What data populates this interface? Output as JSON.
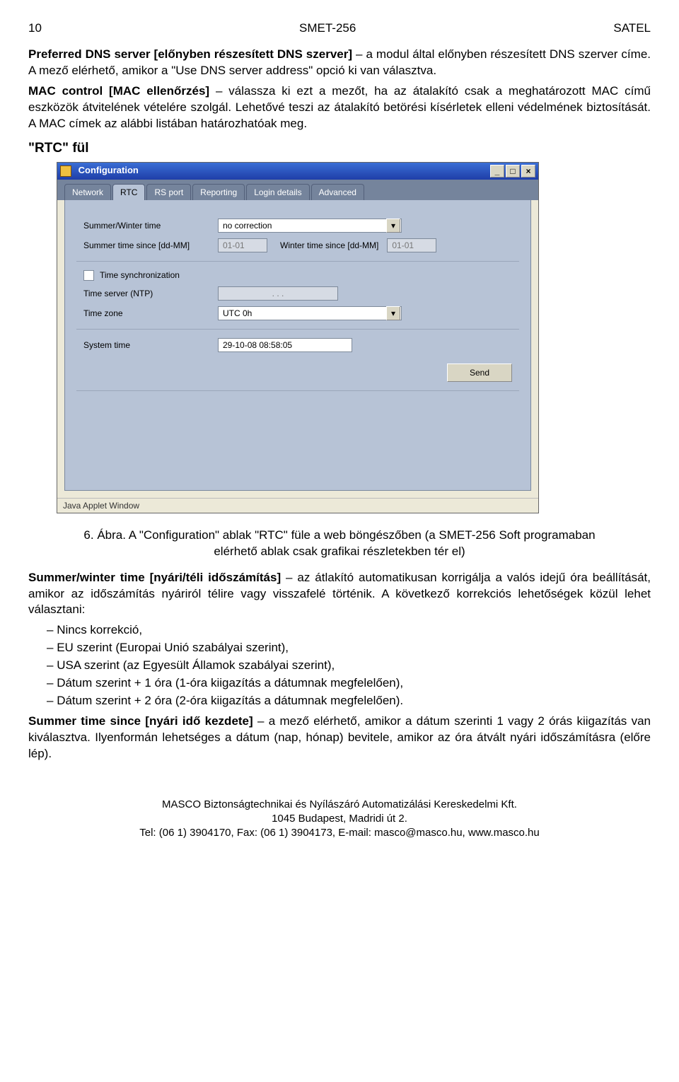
{
  "header": {
    "left": "10",
    "center": "SMET-256",
    "right": "SATEL"
  },
  "intro": {
    "p1_html": "<span class='bold'>Preferred DNS server [előnyben részesített DNS szerver]</span> – a modul által előnyben részesített DNS szerver címe. A mező elérhető, amikor a \"Use DNS server address\" opció ki van választva.",
    "p2_html": "<span class='bold'>MAC control [MAC ellenőrzés]</span> – válassza ki ezt a mezőt, ha az átalakító csak a meghatározott MAC című eszközök átvitelének vételére szolgál. Lehetővé teszi az átalakító betörési kísérletek elleni védelmének biztosítását. A MAC címek az alábbi listában határozhatóak meg."
  },
  "section_title": "\"RTC\" fül",
  "dialog": {
    "title": "Configuration",
    "win_min": "_",
    "win_max": "□",
    "win_close": "×",
    "tabs": [
      "Network",
      "RTC",
      "RS port",
      "Reporting",
      "Login details",
      "Advanced"
    ],
    "active_tab": "RTC",
    "labels": {
      "summer_winter": "Summer/Winter time",
      "summer_since": "Summer time since [dd-MM]",
      "winter_since": "Winter time since [dd-MM]",
      "time_sync": "Time synchronization",
      "ntp": "Time server (NTP)",
      "tz": "Time zone",
      "systime": "System time"
    },
    "values": {
      "summer_winter": "no correction",
      "summer_since": "01-01",
      "winter_since": "01-01",
      "ntp": ".      .      .",
      "tz": "UTC 0h",
      "systime": "29-10-08 08:58:05"
    },
    "send_btn": "Send",
    "status": "Java Applet Window",
    "arrow": "▾"
  },
  "caption": "6. Ábra. A \"Configuration\" ablak \"RTC\" füle a web böngészőben (a SMET-256 Soft programaban elérhető ablak csak grafikai részletekben tér el)",
  "after": {
    "p1_html": "<span class='bold'>Summer/winter time [nyári/téli időszámítás]</span> – az átlakító automatikusan korrigálja a valós idejű óra beállítását, amikor az időszámítás nyáriról télire vagy visszafelé történik. A következő korrekciós lehetőségek közül lehet választani:",
    "list": [
      "Nincs korrekció,",
      "EU szerint (Europai Unió szabályai szerint),",
      "USA szerint (az Egyesült Államok szabályai szerint),",
      "Dátum szerint + 1 óra (1-óra kiigazítás a dátumnak megfelelően),",
      "Dátum szerint + 2 óra (2-óra kiigazítás a dátumnak megfelelően)."
    ],
    "p2_html": "<span class='bold'>Summer time since [nyári idő kezdete]</span> – a mező elérhető, amikor a dátum szerinti 1 vagy 2 órás kiigazítás van kiválasztva. Ilyenformán lehetséges a dátum (nap, hónap) bevitele, amikor az óra átvált nyári időszámításra (előre lép)."
  },
  "footer": {
    "l1": "MASCO Biztonságtechnikai és Nyílászáró Automatizálási Kereskedelmi Kft.",
    "l2": "1045 Budapest, Madridi út 2.",
    "l3": "Tel: (06 1) 3904170, Fax: (06 1) 3904173, E-mail: masco@masco.hu, www.masco.hu"
  }
}
